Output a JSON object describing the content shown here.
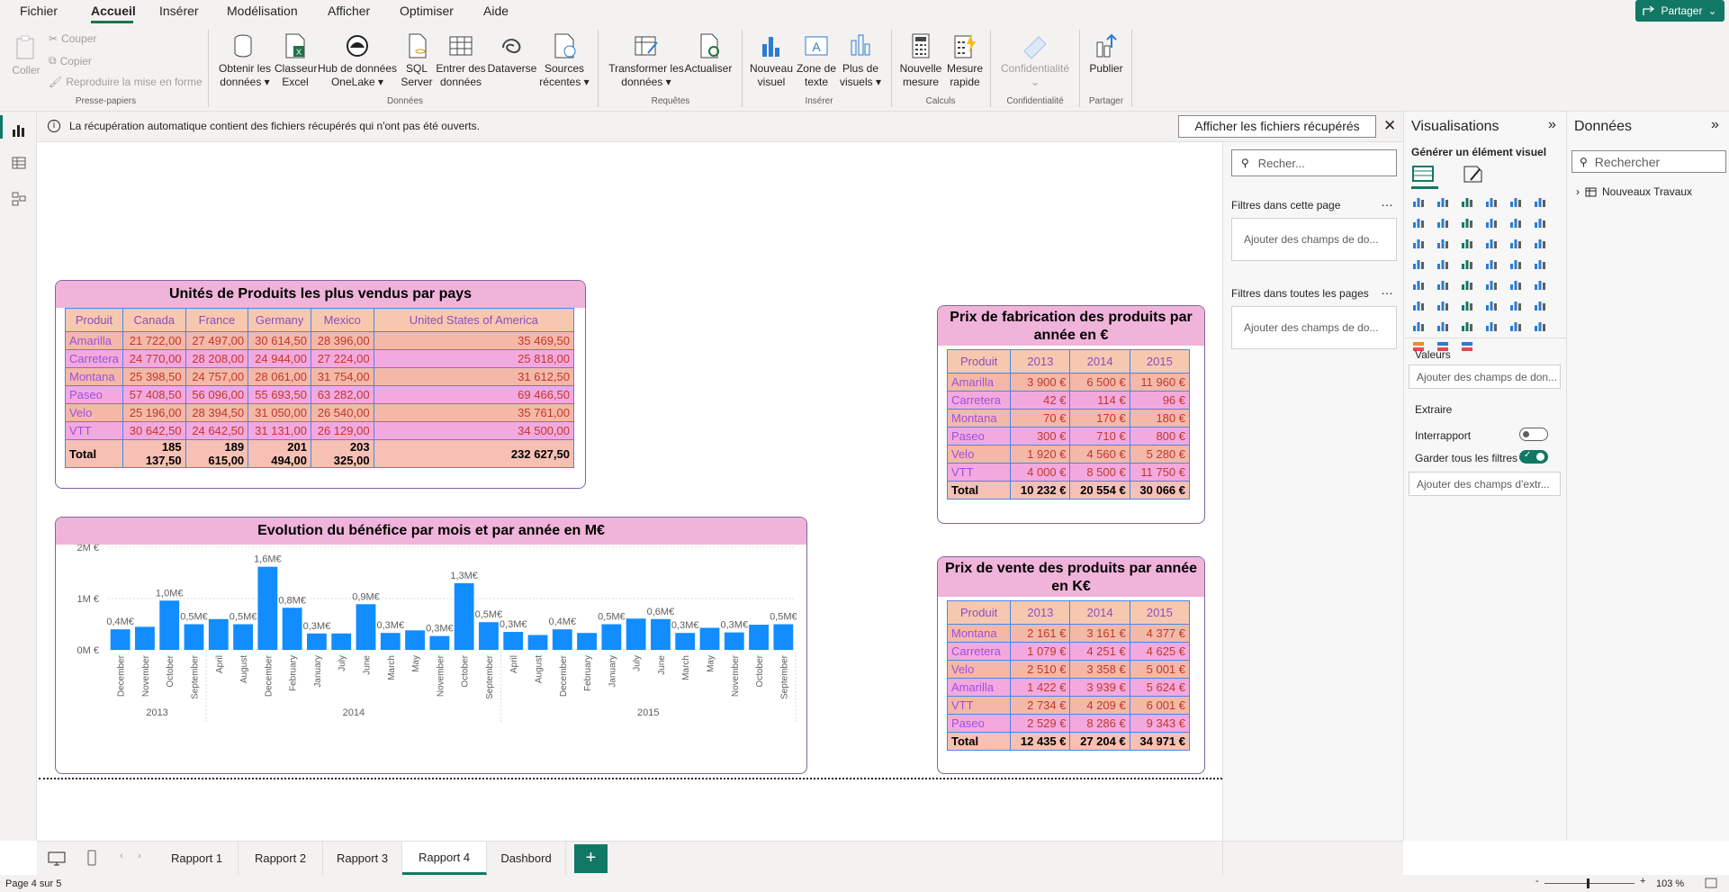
{
  "menu": {
    "items": [
      "Fichier",
      "Accueil",
      "Insérer",
      "Modélisation",
      "Afficher",
      "Optimiser",
      "Aide"
    ],
    "share": "Partager"
  },
  "ribbon": {
    "clipboard": {
      "paste": "Coller",
      "cut": "Couper",
      "copy": "Copier",
      "format_painter": "Reproduire la mise en forme",
      "group": "Presse-papiers"
    },
    "data": {
      "get_data": [
        "Obtenir les",
        "données ▾"
      ],
      "excel": [
        "Classeur",
        "Excel"
      ],
      "onelake": [
        "Hub de données",
        "OneLake ▾"
      ],
      "sql": [
        "SQL",
        "Server"
      ],
      "enter": [
        "Entrer des",
        "données"
      ],
      "dataverse": "Dataverse",
      "recent": [
        "Sources",
        "récentes ▾"
      ],
      "group": "Données"
    },
    "queries": {
      "transform": [
        "Transformer les",
        "données ▾"
      ],
      "refresh": "Actualiser",
      "group": "Requêtes"
    },
    "insert": {
      "new_visual": [
        "Nouveau",
        "visuel"
      ],
      "text_box": [
        "Zone de",
        "texte"
      ],
      "more_visuals": [
        "Plus de",
        "visuels ▾"
      ],
      "group": "Insérer"
    },
    "calc": {
      "new_measure": [
        "Nouvelle",
        "mesure"
      ],
      "quick_measure": [
        "Mesure",
        "rapide"
      ],
      "group": "Calculs"
    },
    "sensitivity": {
      "label": "Confidentialité",
      "group": "Confidentialité"
    },
    "share": {
      "publish": "Publier",
      "group": "Partager"
    }
  },
  "infobar": {
    "message": "La récupération automatique contient des fichiers récupérés qui n'ont pas été ouverts.",
    "button": "Afficher les fichiers récupérés"
  },
  "filters": {
    "search_placeholder": "Recher...",
    "this_page": "Filtres dans cette page",
    "all_pages": "Filtres dans toutes les pages",
    "add_fields": "Ajouter des champs de do..."
  },
  "viz_pane": {
    "title": "Visualisations",
    "build": "Générer un élément visuel",
    "values": "Valeurs",
    "values_add": "Ajouter des champs de don...",
    "drill": "Extraire",
    "cross_report": "Interrapport",
    "keep_filters": "Garder tous les filtres",
    "drill_add": "Ajouter des champs d'extr..."
  },
  "data_pane": {
    "title": "Données",
    "search_placeholder": "Rechercher",
    "table": "Nouveaux Travaux"
  },
  "tabs": [
    "Rapport 1",
    "Rapport 2",
    "Rapport 3",
    "Rapport 4",
    "Dashbord"
  ],
  "status": {
    "page": "Page 4 sur 5",
    "zoom": "103 %"
  },
  "colors": {
    "accent": "#117865",
    "title_bg": "#f0b3da",
    "header_bg": "#f7c8b0",
    "bar": "#118dff"
  },
  "visual_units": {
    "title": "Unités de Produits les plus vendus par pays",
    "headers": [
      "Produit",
      "Canada",
      "France",
      "Germany",
      "Mexico",
      "United States of America"
    ],
    "rows": [
      [
        "Amarilla",
        "21 722,00",
        "27 497,00",
        "30 614,50",
        "28 396,00",
        "35 469,50"
      ],
      [
        "Carretera",
        "24 770,00",
        "28 208,00",
        "24 944,00",
        "27 224,00",
        "25 818,00"
      ],
      [
        "Montana",
        "25 398,50",
        "24 757,00",
        "28 061,00",
        "31 754,00",
        "31 612,50"
      ],
      [
        "Paseo",
        "57 408,50",
        "56 096,00",
        "55 693,50",
        "63 282,00",
        "69 466,50"
      ],
      [
        "Velo",
        "25 196,00",
        "28 394,50",
        "31 050,00",
        "26 540,00",
        "35 761,00"
      ],
      [
        "VTT",
        "30 642,50",
        "24 642,50",
        "31 131,00",
        "26 129,00",
        "34 500,00"
      ]
    ],
    "total": [
      "Total",
      "185 137,50",
      "189 615,00",
      "201 494,00",
      "203 325,00",
      "232 627,50"
    ]
  },
  "visual_fab": {
    "title": "Prix de fabrication des produits par année en €",
    "headers": [
      "Produit",
      "2013",
      "2014",
      "2015"
    ],
    "rows": [
      [
        "Amarilla",
        "3 900 €",
        "6 500 €",
        "11 960 €"
      ],
      [
        "Carretera",
        "42 €",
        "114 €",
        "96 €"
      ],
      [
        "Montana",
        "70 €",
        "170 €",
        "180 €"
      ],
      [
        "Paseo",
        "300 €",
        "710 €",
        "800 €"
      ],
      [
        "Velo",
        "1 920 €",
        "4 560 €",
        "5 280 €"
      ],
      [
        "VTT",
        "4 000 €",
        "8 500 €",
        "11 750 €"
      ]
    ],
    "total": [
      "Total",
      "10 232 €",
      "20 554 €",
      "30 066 €"
    ]
  },
  "visual_sale": {
    "title": "Prix de vente des produits par année en K€",
    "headers": [
      "Produit",
      "2013",
      "2014",
      "2015"
    ],
    "rows": [
      [
        "Montana",
        "2 161 €",
        "3 161 €",
        "4 377 €"
      ],
      [
        "Carretera",
        "1 079 €",
        "4 251 €",
        "4 625 €"
      ],
      [
        "Velo",
        "2 510 €",
        "3 358 €",
        "5 001 €"
      ],
      [
        "Amarilla",
        "1 422 €",
        "3 939 €",
        "5 624 €"
      ],
      [
        "VTT",
        "2 734 €",
        "4 209 €",
        "6 001 €"
      ],
      [
        "Paseo",
        "2 529 €",
        "8 286 €",
        "9 343 €"
      ]
    ],
    "total": [
      "Total",
      "12 435 €",
      "27 204 €",
      "34 971 €"
    ]
  },
  "chart_data": {
    "type": "bar",
    "title": "Evolution du bénéfice par mois et par année en M€",
    "y_ticks": [
      "0M €",
      "1M €",
      "2M €"
    ],
    "ylim": [
      0,
      2
    ],
    "groups": [
      {
        "label": "2013",
        "count": 4
      },
      {
        "label": "2014",
        "count": 12
      },
      {
        "label": "2015",
        "count": 12
      }
    ],
    "categories": [
      "December",
      "November",
      "October",
      "September",
      "April",
      "August",
      "December",
      "February",
      "January",
      "July",
      "June",
      "March",
      "May",
      "November",
      "October",
      "September",
      "April",
      "August",
      "December",
      "February",
      "January",
      "July",
      "June",
      "March",
      "May",
      "November",
      "October",
      "September"
    ],
    "values": [
      0.4,
      0.45,
      0.96,
      0.5,
      0.6,
      0.5,
      1.62,
      0.82,
      0.32,
      0.32,
      0.89,
      0.33,
      0.38,
      0.27,
      1.3,
      0.54,
      0.35,
      0.29,
      0.4,
      0.33,
      0.5,
      0.61,
      0.6,
      0.33,
      0.43,
      0.34,
      0.49,
      0.5
    ],
    "data_labels": [
      "0,4M€",
      "",
      "1,0M€",
      "0,5M€",
      "",
      "0,5M€",
      "1,6M€",
      "0,8M€",
      "0,3M€",
      "",
      "0,9M€",
      "0,3M€",
      "",
      "0,3M€",
      "1,3M€",
      "0,5M€",
      "0,3M€",
      "",
      "0,4M€",
      "",
      "0,5M€",
      "",
      "0,6M€",
      "0,3M€",
      "",
      "0,3M€",
      "",
      "0,5M€"
    ],
    "grid": true
  }
}
